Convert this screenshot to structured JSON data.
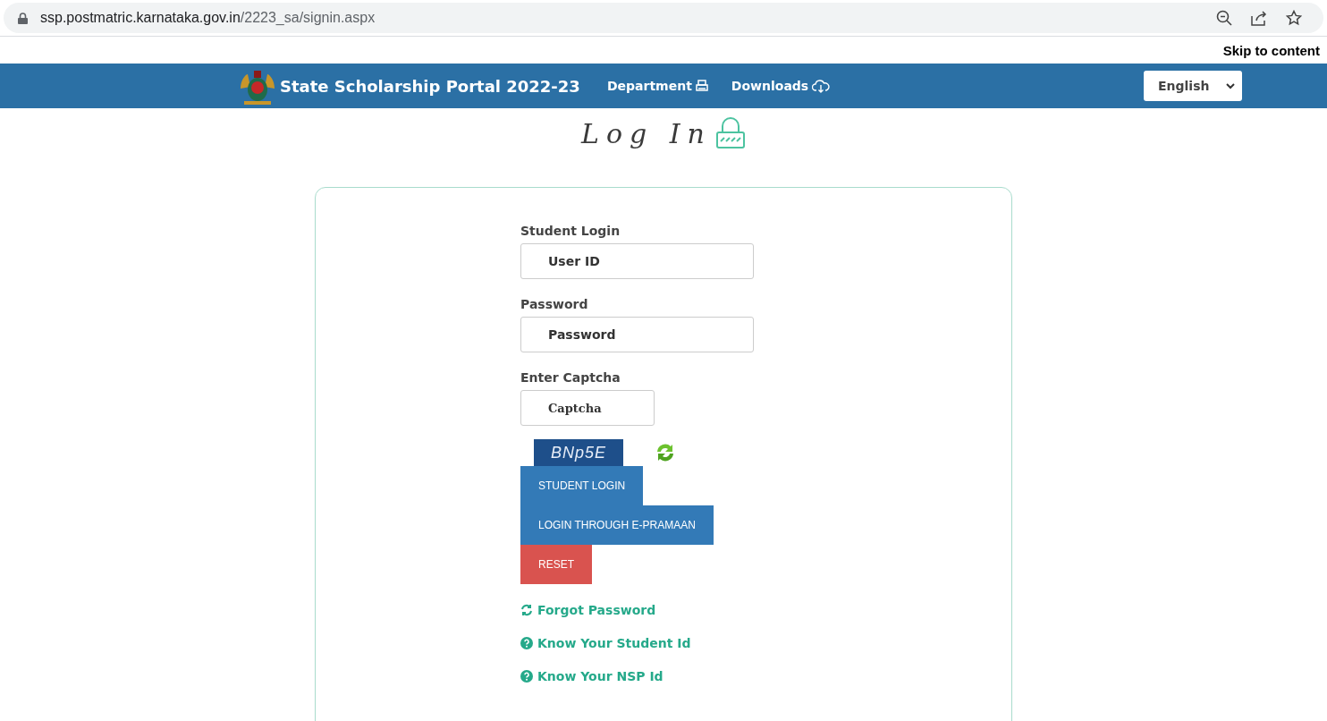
{
  "browser": {
    "url_host": "ssp.postmatric.karnataka.gov.in",
    "url_path": "/2223_sa/signin.aspx"
  },
  "skip_link": "Skip to content",
  "header": {
    "title": "State Scholarship Portal 2022-23",
    "nav": [
      {
        "label": "Department",
        "kind": "printer"
      },
      {
        "label": "Downloads",
        "kind": "cloud"
      }
    ],
    "language": "English"
  },
  "heading": "Log In",
  "form": {
    "fields": [
      {
        "label": "Student Login",
        "placeholder": "User ID",
        "kind": "wide"
      },
      {
        "label": "Password",
        "placeholder": "Password",
        "kind": "wide"
      },
      {
        "label": "Enter Captcha",
        "placeholder": "Captcha",
        "kind": "narrow"
      }
    ],
    "captcha_text": "BNp5E",
    "buttons": [
      {
        "label": "STUDENT LOGIN",
        "kind": "primary"
      },
      {
        "label": "LOGIN THROUGH E-PRAMAAN",
        "kind": "primary"
      },
      {
        "label": "RESET",
        "kind": "danger"
      }
    ],
    "links": [
      {
        "label": "Forgot Password",
        "kind": "refresh"
      },
      {
        "label": "Know Your Student Id",
        "kind": "question"
      },
      {
        "label": "Know Your NSP Id",
        "kind": "question"
      }
    ]
  }
}
